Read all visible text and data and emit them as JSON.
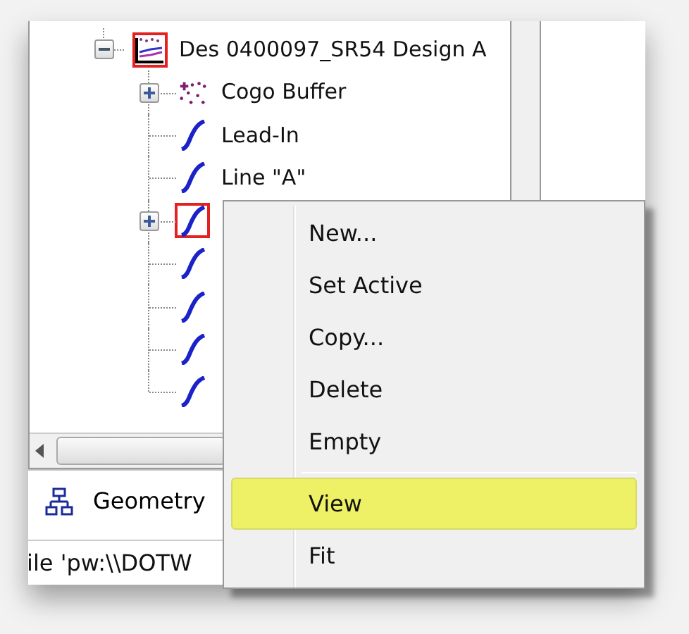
{
  "tree": {
    "items": [
      {
        "label": "Des 0400097_SR54 Design A",
        "kind": "design",
        "marked": true,
        "expanded": true,
        "children": [
          {
            "label": "Cogo Buffer",
            "kind": "points",
            "marked": false,
            "expanded": false
          },
          {
            "label": "Lead-In",
            "kind": "alignment",
            "marked": false
          },
          {
            "label": "Line \"A\"",
            "kind": "alignment",
            "marked": false
          },
          {
            "kind": "alignment",
            "marked": true,
            "expanded": false
          },
          {
            "kind": "alignment",
            "marked": false
          },
          {
            "kind": "alignment",
            "marked": false
          },
          {
            "kind": "alignment",
            "marked": false
          },
          {
            "kind": "alignment",
            "marked": false
          }
        ]
      }
    ]
  },
  "tabs": [
    {
      "label": "Geometry",
      "selected": true
    }
  ],
  "status_bar": {
    "text": "ile 'pw:\\\\DOTW"
  },
  "context_menu": {
    "items": [
      {
        "kind": "item",
        "label": "New...",
        "highlighted": false
      },
      {
        "kind": "item",
        "label": "Set Active",
        "highlighted": false
      },
      {
        "kind": "item",
        "label": "Copy...",
        "highlighted": false
      },
      {
        "kind": "item",
        "label": "Delete",
        "highlighted": false
      },
      {
        "kind": "item",
        "label": "Empty",
        "highlighted": false
      },
      {
        "kind": "separator"
      },
      {
        "kind": "item",
        "label": "View",
        "highlighted": true
      },
      {
        "kind": "item",
        "label": "Fit",
        "highlighted": false
      }
    ]
  }
}
